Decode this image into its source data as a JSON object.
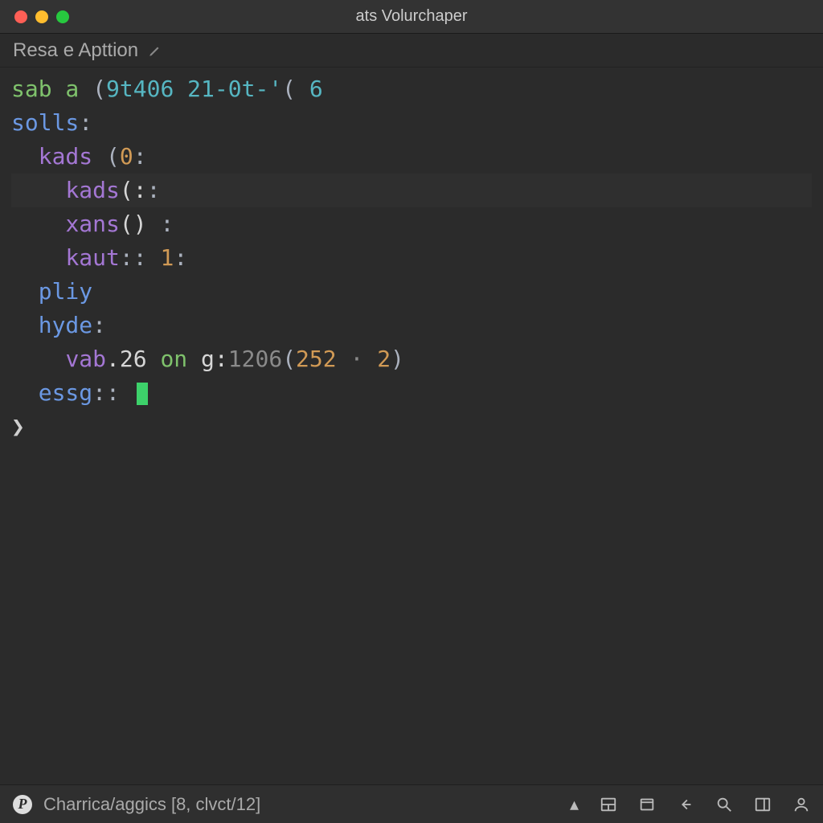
{
  "window": {
    "title": "ats Volurchaper"
  },
  "tab": {
    "label": "Resa e Apttion"
  },
  "code": {
    "l1_a": "sab a ",
    "l1_b": "(",
    "l1_c": "9t406 21-0t-'",
    "l1_d": "( ",
    "l1_e": "6",
    "l2": "solls",
    "l3_a": "kads ",
    "l3_b": "(",
    "l3_c": "0",
    "l3_d": ":",
    "l4_a": "kads",
    "l4_b": "(:",
    "l4_c": ":",
    "l5_a": "xans",
    "l5_b": "()",
    "l5_c": " :",
    "l6_a": "kaut",
    "l6_b": ":: ",
    "l6_c": "1",
    "l6_d": ":",
    "l7": "pliy",
    "l8_a": "hyde",
    "l8_b": ":",
    "l9_a": "vab",
    "l9_b": ".26 ",
    "l9_c": "on ",
    "l9_d": "g:",
    "l9_e": "1206",
    "l9_f": "(",
    "l9_g": "252",
    "l9_h": " · ",
    "l9_i": "2",
    "l9_j": ")",
    "l10_a": "essg",
    "l10_b": ":: ",
    "prompt": "❯"
  },
  "status": {
    "branch": "Charrica/aggics [8, clvct/12]",
    "badge": "P",
    "chevron": "▴"
  }
}
